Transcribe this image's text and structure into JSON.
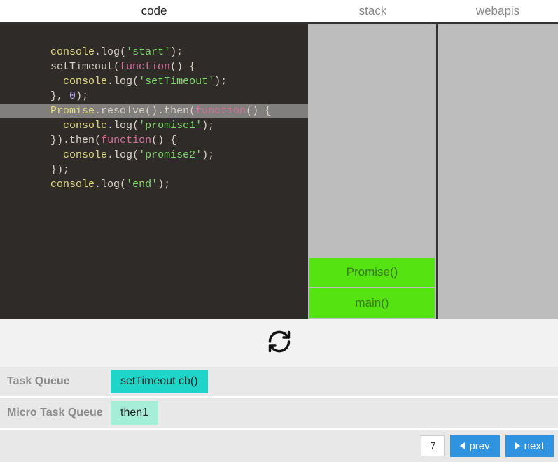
{
  "header": {
    "code": "code",
    "stack": "stack",
    "webapis": "webapis"
  },
  "code": {
    "highlighted_index": 6,
    "tokens": [
      [],
      [
        {
          "t": "console",
          "c": "kw-console"
        },
        {
          "t": ".",
          "c": "kw-punct"
        },
        {
          "t": "log",
          "c": "kw-method"
        },
        {
          "t": "(",
          "c": "kw-paren"
        },
        {
          "t": "'start'",
          "c": "kw-string"
        },
        {
          "t": ")",
          "c": "kw-paren"
        },
        {
          "t": ";",
          "c": "kw-punct"
        }
      ],
      [],
      [
        {
          "t": "setTimeout",
          "c": "kw-method"
        },
        {
          "t": "(",
          "c": "kw-paren"
        },
        {
          "t": "function",
          "c": "kw-func"
        },
        {
          "t": "()",
          "c": "kw-paren"
        },
        {
          "t": " {",
          "c": "kw-brace"
        }
      ],
      [
        {
          "t": "  ",
          "c": ""
        },
        {
          "t": "console",
          "c": "kw-console"
        },
        {
          "t": ".",
          "c": "kw-punct"
        },
        {
          "t": "log",
          "c": "kw-method"
        },
        {
          "t": "(",
          "c": "kw-paren"
        },
        {
          "t": "'setTimeout'",
          "c": "kw-string"
        },
        {
          "t": ")",
          "c": "kw-paren"
        },
        {
          "t": ";",
          "c": "kw-punct"
        }
      ],
      [
        {
          "t": "},",
          "c": "kw-brace"
        },
        {
          "t": " ",
          "c": ""
        },
        {
          "t": "0",
          "c": "kw-num"
        },
        {
          "t": ")",
          "c": "kw-paren"
        },
        {
          "t": ";",
          "c": "kw-punct"
        }
      ],
      [],
      [
        {
          "t": "Promise",
          "c": "kw-promise"
        },
        {
          "t": ".",
          "c": "kw-punct"
        },
        {
          "t": "resolve",
          "c": "kw-method"
        },
        {
          "t": "()",
          "c": "kw-paren"
        },
        {
          "t": ".",
          "c": "kw-punct"
        },
        {
          "t": "then",
          "c": "kw-method"
        },
        {
          "t": "(",
          "c": "kw-paren"
        },
        {
          "t": "function",
          "c": "kw-func"
        },
        {
          "t": "()",
          "c": "kw-paren"
        },
        {
          "t": " {",
          "c": "kw-brace"
        }
      ],
      [
        {
          "t": "  ",
          "c": ""
        },
        {
          "t": "console",
          "c": "kw-console"
        },
        {
          "t": ".",
          "c": "kw-punct"
        },
        {
          "t": "log",
          "c": "kw-method"
        },
        {
          "t": "(",
          "c": "kw-paren"
        },
        {
          "t": "'promise1'",
          "c": "kw-string"
        },
        {
          "t": ")",
          "c": "kw-paren"
        },
        {
          "t": ";",
          "c": "kw-punct"
        }
      ],
      [
        {
          "t": "})",
          "c": "kw-brace"
        },
        {
          "t": ".",
          "c": "kw-punct"
        },
        {
          "t": "then",
          "c": "kw-method"
        },
        {
          "t": "(",
          "c": "kw-paren"
        },
        {
          "t": "function",
          "c": "kw-func"
        },
        {
          "t": "()",
          "c": "kw-paren"
        },
        {
          "t": " {",
          "c": "kw-brace"
        }
      ],
      [
        {
          "t": "  ",
          "c": ""
        },
        {
          "t": "console",
          "c": "kw-console"
        },
        {
          "t": ".",
          "c": "kw-punct"
        },
        {
          "t": "log",
          "c": "kw-method"
        },
        {
          "t": "(",
          "c": "kw-paren"
        },
        {
          "t": "'promise2'",
          "c": "kw-string"
        },
        {
          "t": ")",
          "c": "kw-paren"
        },
        {
          "t": ";",
          "c": "kw-punct"
        }
      ],
      [
        {
          "t": "})",
          "c": "kw-brace"
        },
        {
          "t": ";",
          "c": "kw-punct"
        }
      ],
      [],
      [
        {
          "t": "console",
          "c": "kw-console"
        },
        {
          "t": ".",
          "c": "kw-punct"
        },
        {
          "t": "log",
          "c": "kw-method"
        },
        {
          "t": "(",
          "c": "kw-paren"
        },
        {
          "t": "'end'",
          "c": "kw-string"
        },
        {
          "t": ")",
          "c": "kw-paren"
        },
        {
          "t": ";",
          "c": "kw-punct"
        }
      ]
    ]
  },
  "stack": [
    "Promise()",
    "main()"
  ],
  "webapis": [],
  "queues": {
    "task_label": "Task Queue",
    "microtask_label": "Micro Task Queue",
    "task_items": [
      "setTimeout cb()"
    ],
    "microtask_items": [
      "then1"
    ]
  },
  "footer": {
    "step": "7",
    "prev": "prev",
    "next": "next"
  },
  "colors": {
    "stack_frame": "#56e312",
    "task_item": "#1fd4c8",
    "microtask_item": "#a6eed8",
    "nav_btn": "#2f93e0"
  }
}
